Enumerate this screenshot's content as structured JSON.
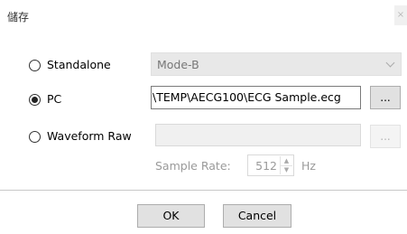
{
  "window": {
    "title": "儲存",
    "close_glyph": "×"
  },
  "options": {
    "standalone": {
      "label": "Standalone",
      "selected": false
    },
    "pc": {
      "label": "PC",
      "selected": true
    },
    "waveform_raw": {
      "label": "Waveform Raw",
      "selected": false
    }
  },
  "standalone_mode": {
    "value": "Mode-B"
  },
  "pc_path": {
    "value": "\\TEMP\\AECG100\\ECG Sample.ecg"
  },
  "browse": {
    "label": "..."
  },
  "sample_rate": {
    "label": "Sample Rate:",
    "value": "512",
    "unit": "Hz"
  },
  "buttons": {
    "ok": "OK",
    "cancel": "Cancel"
  }
}
